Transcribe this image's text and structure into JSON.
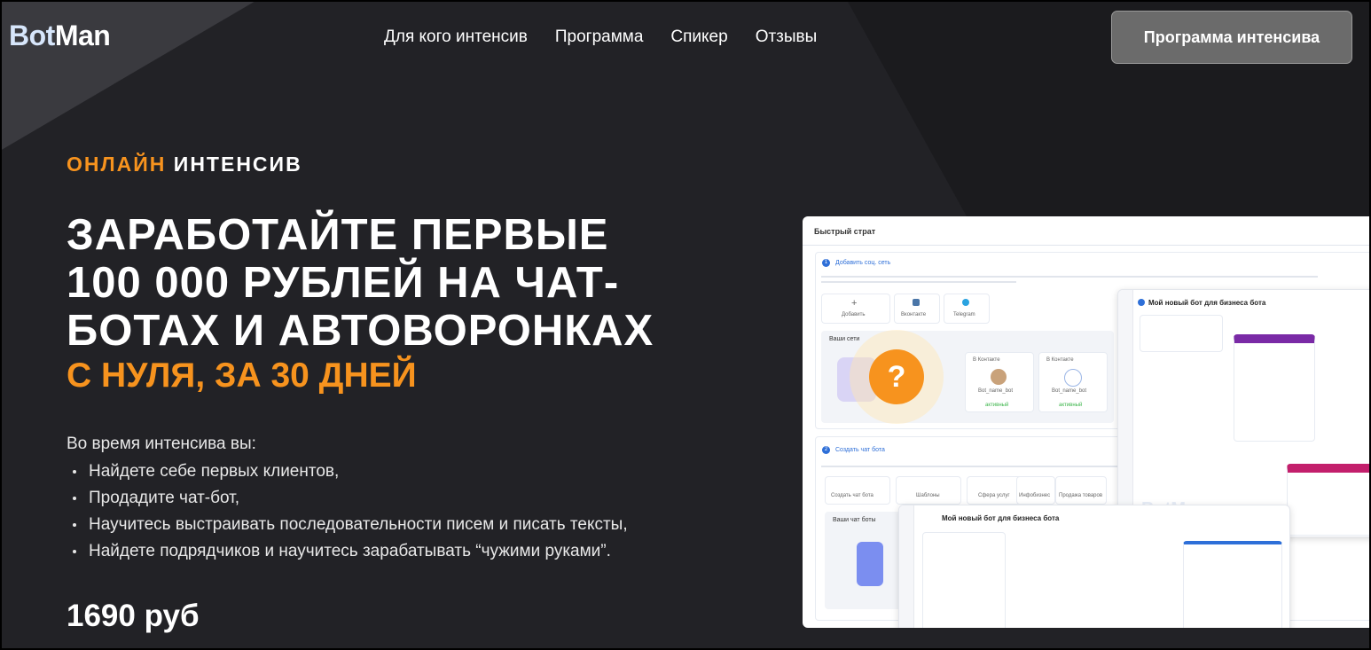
{
  "header": {
    "logo_bot": "Bot",
    "logo_man": "Man",
    "nav": [
      "Для кого интенсив",
      "Программа",
      "Спикер",
      "Отзывы"
    ],
    "cta_label": "Программа интенсива"
  },
  "hero": {
    "eyebrow_orange": "ОНЛАЙН",
    "eyebrow_white": "ИНТЕНСИВ",
    "headline_lines": [
      "ЗАРАБОТАЙТЕ ПЕРВЫЕ",
      "100 000 РУБЛЕЙ НА ЧАТ-",
      "БОТАХ И АВТОВОРОНКАХ"
    ],
    "subhead": "С НУЛЯ, ЗА 30 ДНЕЙ",
    "intro": "Во время интенсива вы:",
    "bullets": [
      "Найдете себе первых клиентов,",
      "Продадите чат-бот,",
      "Научитесь выстраивать последовательности писем и писать тексты,",
      "Найдете подрядчиков и научитесь зарабатывать “чужими руками”."
    ],
    "price": "1690 руб"
  },
  "mockup": {
    "title": "Быстрый страт",
    "step1": "Добавить соц. сеть",
    "step2": "Создать чат бота",
    "add_label": "Добавить",
    "networks": [
      "Вконтакте",
      "Telegram"
    ],
    "your_networks": "Ваши сети",
    "your_bots": "Ваши чат боты",
    "bot_cards": [
      "В Контакте",
      "В Контакте"
    ],
    "bot_name": "Bot_name_bot",
    "status_active": "активный",
    "create_options": [
      "Создать чат бота",
      "Шаблоны",
      "Сфера услуг",
      "Инфобизнес",
      "Продажа товаров"
    ],
    "panel_title": "Мой новый бот для бизнеса бота",
    "watermark": "BotMan",
    "question_mark": "?"
  },
  "colors": {
    "accent": "#f7931e",
    "background": "#222226",
    "cta_bg": "#6b6b6b",
    "mock_blue": "#2e6fd8"
  }
}
